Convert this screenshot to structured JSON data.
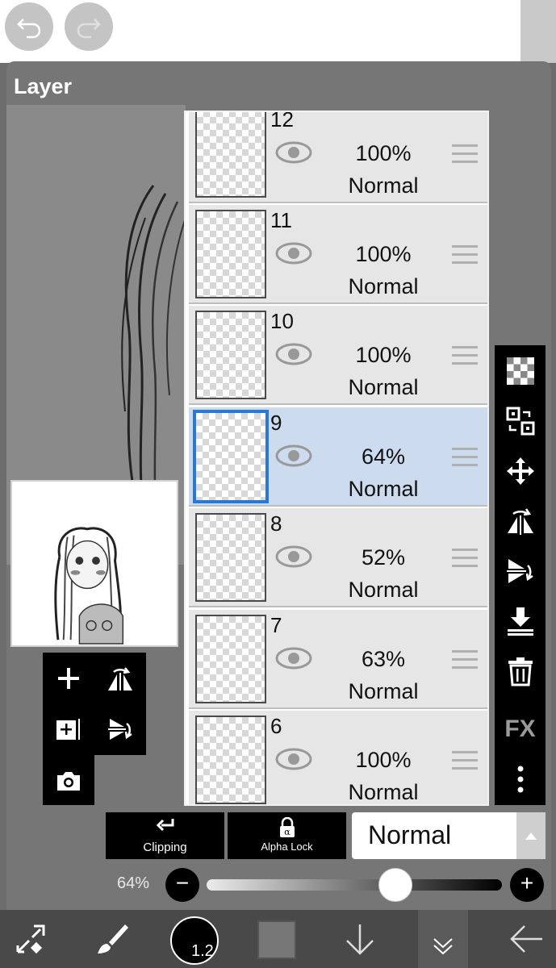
{
  "panel": {
    "title": "Layer"
  },
  "layers": [
    {
      "number": "12",
      "opacity": "100%",
      "blend": "Normal",
      "selected": false
    },
    {
      "number": "11",
      "opacity": "100%",
      "blend": "Normal",
      "selected": false
    },
    {
      "number": "10",
      "opacity": "100%",
      "blend": "Normal",
      "selected": false
    },
    {
      "number": "9",
      "opacity": "64%",
      "blend": "Normal",
      "selected": true
    },
    {
      "number": "8",
      "opacity": "52%",
      "blend": "Normal",
      "selected": false
    },
    {
      "number": "7",
      "opacity": "63%",
      "blend": "Normal",
      "selected": false
    },
    {
      "number": "6",
      "opacity": "100%",
      "blend": "Normal",
      "selected": false
    }
  ],
  "right_toolbar": {
    "icons": [
      "checkerboard-icon",
      "swap-layer-icon",
      "move-icon",
      "flip-horizontal-icon",
      "flip-vertical-icon",
      "merge-down-icon",
      "trash-icon",
      "fx-icon",
      "more-icon"
    ],
    "fx_label": "FX"
  },
  "controls": {
    "clipping_label": "Clipping",
    "alpha_lock_label": "Alpha Lock",
    "blend_mode": "Normal",
    "opacity_label": "64%",
    "opacity_value": 0.64,
    "minus": "−",
    "plus": "+"
  },
  "bottom_toolbar": {
    "brush_size": "1.2",
    "icons": [
      "transform-icon",
      "brush-icon",
      "brush-size-icon",
      "color-icon",
      "download-icon",
      "layers-icon",
      "back-icon"
    ]
  },
  "colors": {
    "selected_row": "#cddbef",
    "selected_border": "#2a78d4"
  }
}
